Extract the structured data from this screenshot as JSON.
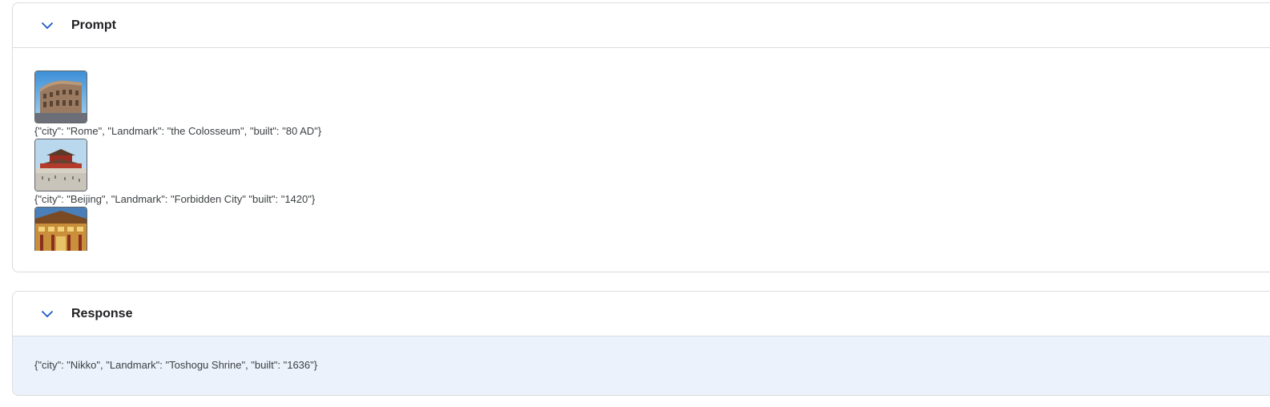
{
  "prompt": {
    "title": "Prompt",
    "items": [
      {
        "image": "colosseum-image",
        "text": "{\"city\": \"Rome\", \"Landmark\": \"the Colosseum\", \"built\": \"80 AD\"}"
      },
      {
        "image": "forbidden-city-image",
        "text": "{\"city\": \"Beijing\", \"Landmark\": \"Forbidden City\" \"built\": \"1420\"}"
      },
      {
        "image": "toshogu-shrine-image",
        "text": ""
      }
    ]
  },
  "response": {
    "title": "Response",
    "text": "{\"city\": \"Nikko\", \"Landmark\": \"Toshogu Shrine\", \"built\": \"1636\"}"
  },
  "colors": {
    "accent": "#1a73e8",
    "response_bg": "#ecf2fc",
    "border": "#dadce0"
  },
  "icons": {
    "collapse": "chevron-down-icon"
  }
}
